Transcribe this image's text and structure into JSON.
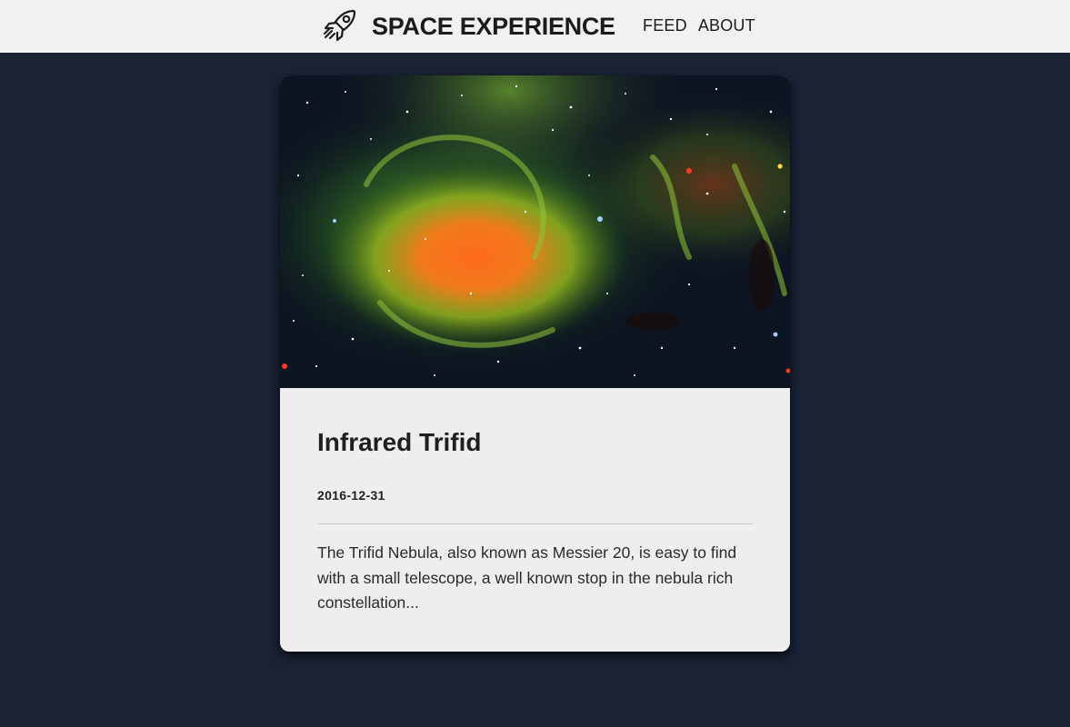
{
  "header": {
    "brand_icon": "rocket-icon",
    "brand_title": "SPACE EXPERIENCE",
    "nav": [
      {
        "label": "FEED"
      },
      {
        "label": "ABOUT"
      }
    ]
  },
  "card": {
    "image": "nebula-image",
    "title": "Infrared Trifid",
    "date": "2016-12-31",
    "excerpt": "The Trifid Nebula, also known as Messier 20, is easy to find with a small telescope, a well known stop in the nebula rich constellation..."
  },
  "colors": {
    "page_background": "#1a2436",
    "header_background": "#eff1f3",
    "card_background": "#eeeeee",
    "text": "#1f1f1f"
  }
}
